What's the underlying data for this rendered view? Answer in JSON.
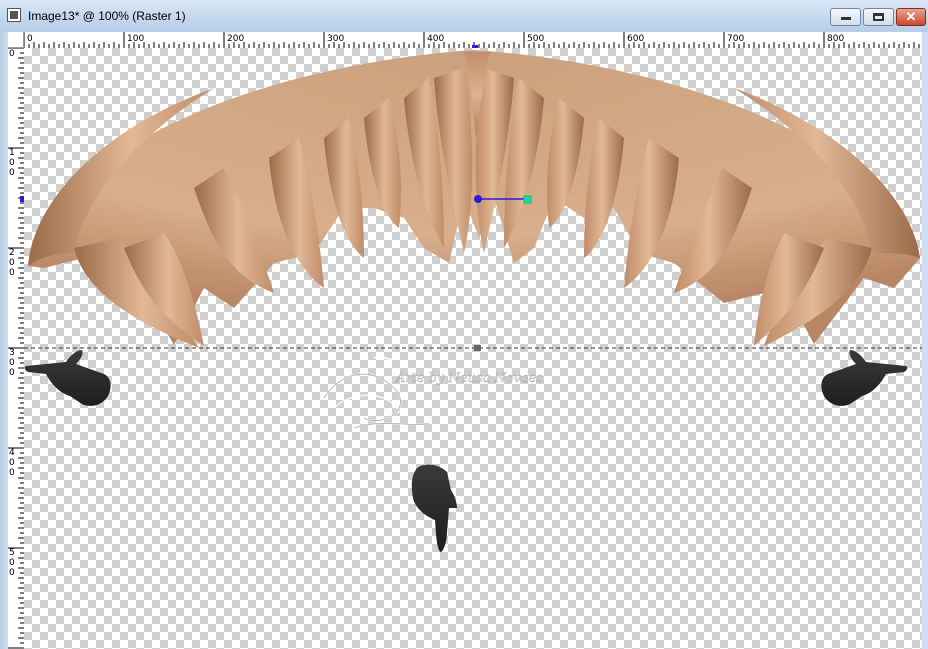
{
  "window": {
    "title": "Image13* @ 100% (Raster 1)",
    "controls": {
      "minimize": "minimize",
      "maximize": "maximize",
      "close": "✕"
    }
  },
  "rulers": {
    "top_labels": [
      "0",
      "100",
      "200",
      "300",
      "400",
      "500",
      "600",
      "700",
      "800"
    ],
    "left_labels": [
      [
        "0"
      ],
      [
        "1",
        "0",
        "0"
      ],
      [
        "2",
        "0",
        "0"
      ],
      [
        "3",
        "0",
        "0"
      ],
      [
        "4",
        "0",
        "0"
      ],
      [
        "5",
        "0",
        "0"
      ]
    ]
  },
  "canvas": {
    "layer": "Raster 1",
    "content": "hair-fringe",
    "hair_colors": {
      "light": "#e2b896",
      "mid": "#c99771",
      "dark": "#9b6a49"
    },
    "watermark": "Arte by Neusa Novaes",
    "guide": {
      "type": "horizontal-dashed-line",
      "arrows_pointing": [
        "left-hand",
        "right-hand",
        "down-hand"
      ]
    }
  }
}
